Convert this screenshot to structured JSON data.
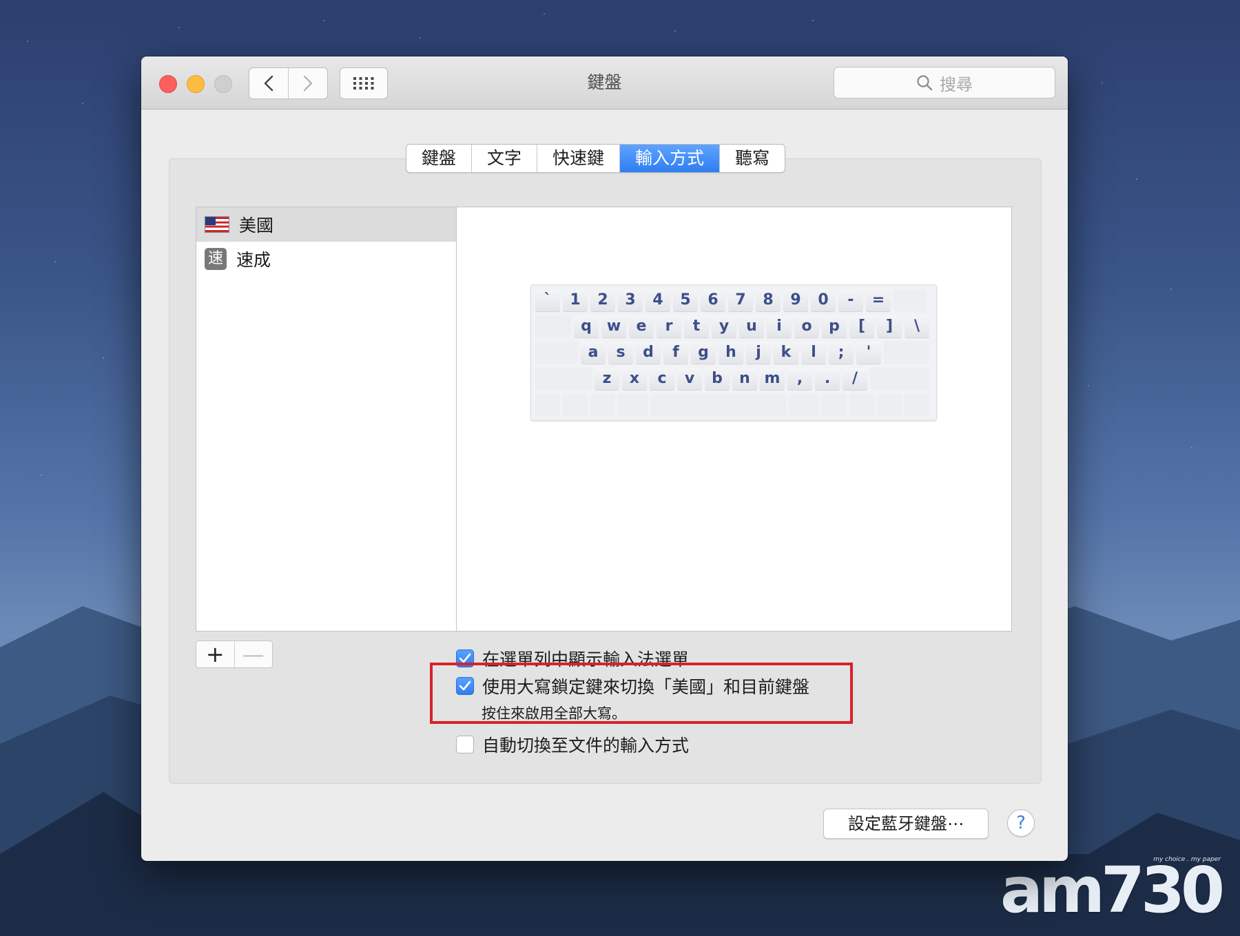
{
  "window": {
    "title": "鍵盤"
  },
  "search": {
    "placeholder": "搜尋"
  },
  "tabs": [
    {
      "label": "鍵盤",
      "active": false
    },
    {
      "label": "文字",
      "active": false
    },
    {
      "label": "快速鍵",
      "active": false
    },
    {
      "label": "輸入方式",
      "active": true
    },
    {
      "label": "聽寫",
      "active": false
    }
  ],
  "input_sources": [
    {
      "label": "美國",
      "icon": "us-flag-icon",
      "selected": true
    },
    {
      "label": "速成",
      "badge": "速",
      "icon": "sucheng-icon",
      "selected": false
    }
  ],
  "keyboard": {
    "row1": [
      "`",
      "1",
      "2",
      "3",
      "4",
      "5",
      "6",
      "7",
      "8",
      "9",
      "0",
      "-",
      "="
    ],
    "row2": [
      "q",
      "w",
      "e",
      "r",
      "t",
      "y",
      "u",
      "i",
      "o",
      "p",
      "[",
      "]",
      "\\"
    ],
    "row3": [
      "a",
      "s",
      "d",
      "f",
      "g",
      "h",
      "j",
      "k",
      "l",
      ";",
      "'"
    ],
    "row4": [
      "z",
      "x",
      "c",
      "v",
      "b",
      "n",
      "m",
      ",",
      ".",
      "/"
    ]
  },
  "list_controls": {
    "add": "+",
    "remove": "—"
  },
  "options": {
    "show_menu": {
      "label": "在選單列中顯示輸入法選單",
      "checked": true
    },
    "capslock_switch": {
      "label": "使用大寫鎖定鍵來切換「美國」和目前鍵盤",
      "checked": true,
      "hint": "按住來啟用全部大寫。"
    },
    "auto_switch": {
      "label": "自動切換至文件的輸入方式",
      "checked": false
    }
  },
  "buttons": {
    "bluetooth": "設定藍牙鍵盤⋯",
    "help": "?"
  },
  "colors": {
    "accent": "#2f7ef0",
    "highlight_box": "#d8222a"
  },
  "watermark": {
    "tagline": "my choice . my paper",
    "brand": "am730"
  }
}
